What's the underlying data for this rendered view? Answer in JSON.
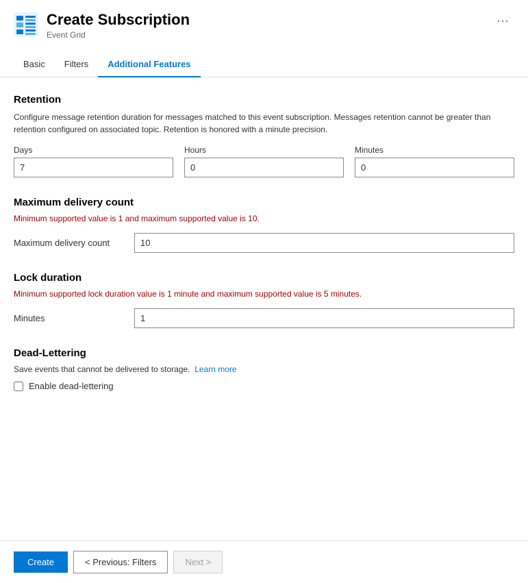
{
  "header": {
    "title": "Create Subscription",
    "subtitle": "Event Grid",
    "more_icon": "···"
  },
  "tabs": [
    {
      "label": "Basic",
      "active": false
    },
    {
      "label": "Filters",
      "active": false
    },
    {
      "label": "Additional Features",
      "active": true
    }
  ],
  "retention": {
    "title": "Retention",
    "description": "Configure message retention duration for messages matched to this event subscription. Messages retention cannot be greater than retention configured on associated topic. Retention is honored with a minute precision.",
    "days_label": "Days",
    "days_value": "7",
    "hours_label": "Hours",
    "hours_value": "0",
    "minutes_label": "Minutes",
    "minutes_value": "0"
  },
  "delivery": {
    "title": "Maximum delivery count",
    "warning": "Minimum supported value is 1 and maximum supported value is 10.",
    "label": "Maximum delivery count",
    "value": "10"
  },
  "lock": {
    "title": "Lock duration",
    "warning": "Minimum supported lock duration value is 1 minute and maximum supported value is 5 minutes.",
    "label": "Minutes",
    "value": "1"
  },
  "deadlettering": {
    "title": "Dead-Lettering",
    "description": "Save events that cannot be delivered to storage.",
    "learn_more_label": "Learn more",
    "checkbox_label": "Enable dead-lettering",
    "checked": false
  },
  "footer": {
    "create_label": "Create",
    "previous_label": "< Previous: Filters",
    "next_label": "Next >"
  }
}
